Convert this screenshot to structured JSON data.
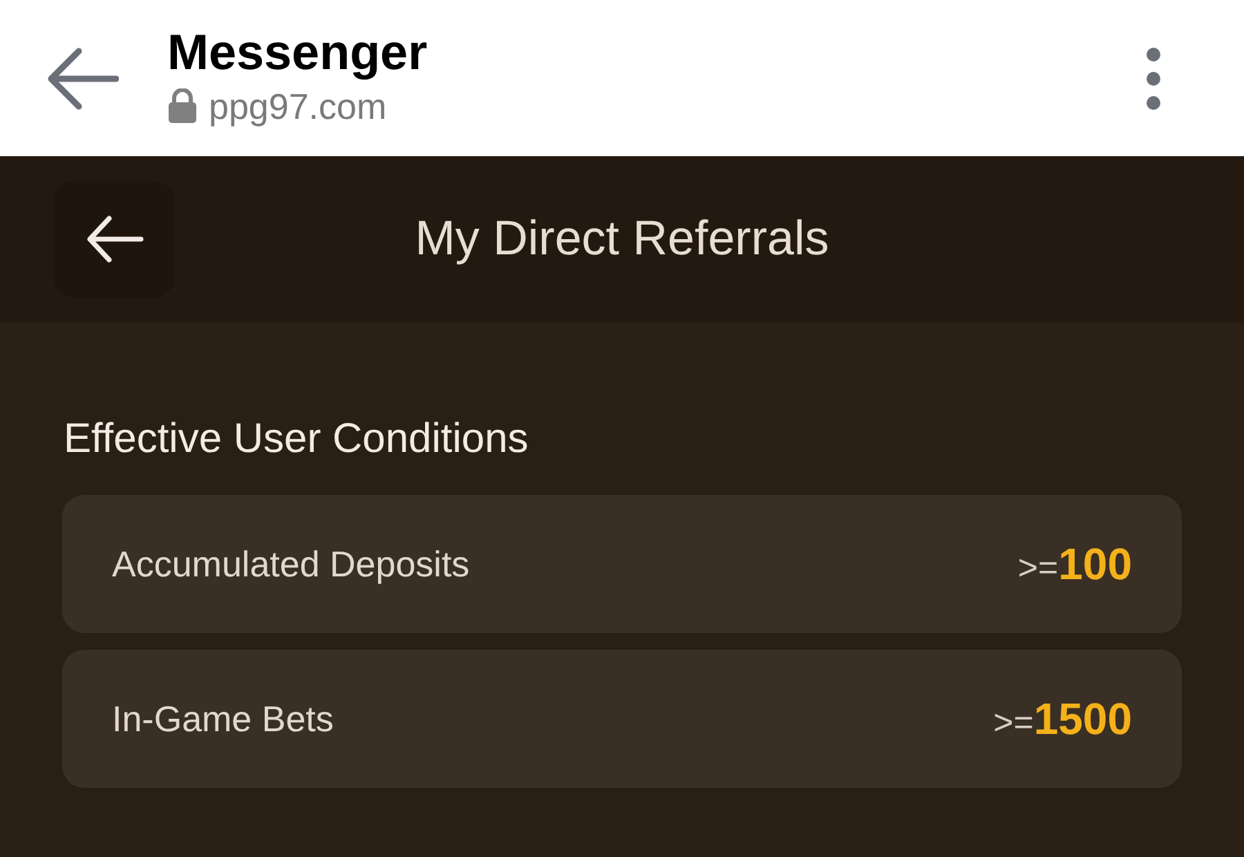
{
  "browser_bar": {
    "title": "Messenger",
    "url": "ppg97.com"
  },
  "page_header": {
    "title": "My Direct Referrals"
  },
  "section": {
    "title": "Effective User Conditions"
  },
  "conditions": [
    {
      "label": "Accumulated Deposits",
      "operator": ">=",
      "value": "100"
    },
    {
      "label": "In-Game Bets",
      "operator": ">=",
      "value": "1500"
    }
  ]
}
